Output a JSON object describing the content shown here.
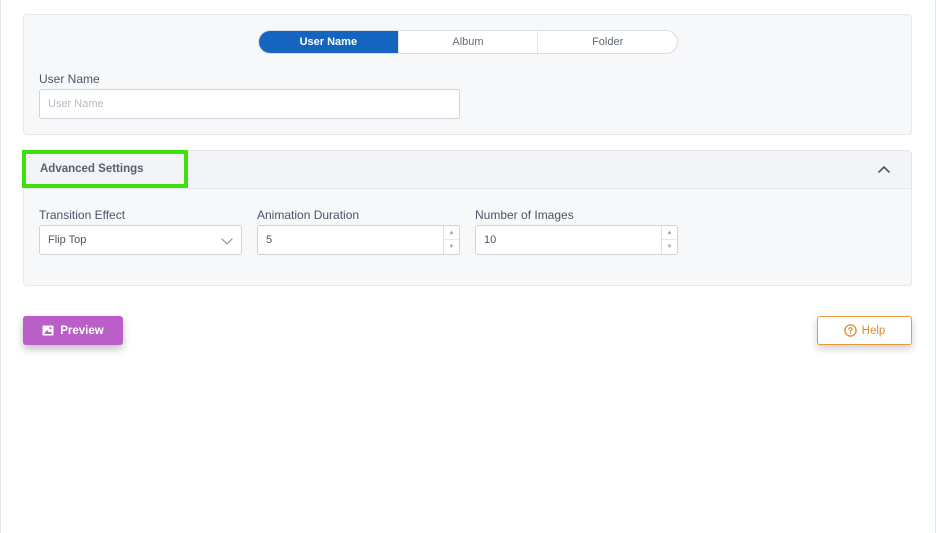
{
  "source": {
    "tabs": [
      {
        "label": "User Name",
        "active": true
      },
      {
        "label": "Album",
        "active": false
      },
      {
        "label": "Folder",
        "active": false
      }
    ],
    "user_name_label": "User Name",
    "user_name_placeholder": "User Name",
    "user_name_value": ""
  },
  "advanced": {
    "title": "Advanced Settings",
    "expanded": true,
    "transition_label": "Transition Effect",
    "transition_value": "Flip Top",
    "duration_label": "Animation Duration",
    "duration_value": "5",
    "images_label": "Number of Images",
    "images_value": "10"
  },
  "buttons": {
    "preview_label": "Preview",
    "help_label": "Help"
  },
  "colors": {
    "active_tab": "#1565c0",
    "preview_button": "#b95fc7",
    "help_accent": "#e08a2c",
    "highlight": "#3ee00d"
  },
  "icons": {
    "expand": "chevron-up-icon",
    "select": "chevron-down-icon",
    "preview": "image-icon",
    "help": "question-circle-icon"
  }
}
